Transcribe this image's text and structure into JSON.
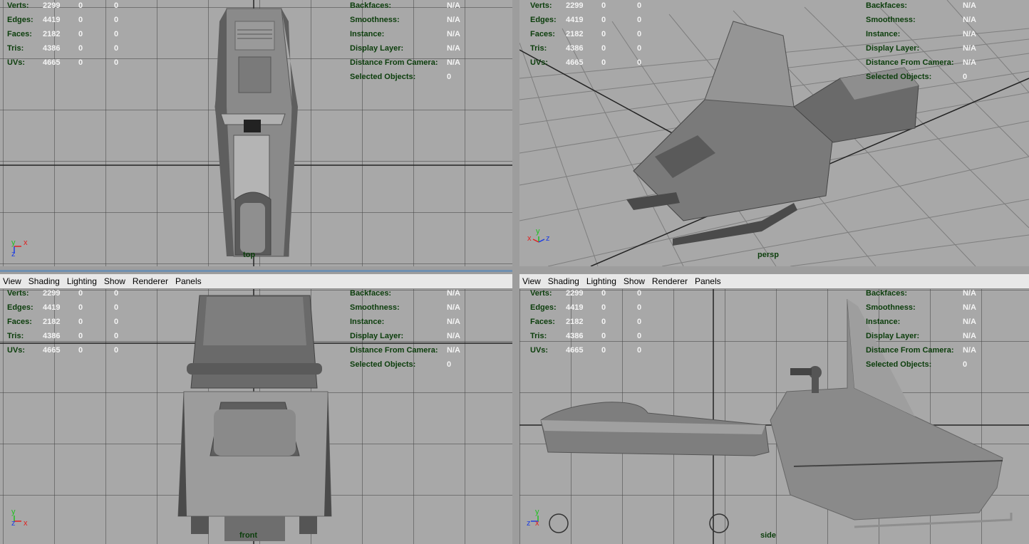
{
  "menu": [
    "View",
    "Shading",
    "Lighting",
    "Show",
    "Renderer",
    "Panels"
  ],
  "hud_stats": [
    {
      "label": "Verts:",
      "v1": "2299",
      "v2": "0",
      "v3": "0"
    },
    {
      "label": "Edges:",
      "v1": "4419",
      "v2": "0",
      "v3": "0"
    },
    {
      "label": "Faces:",
      "v1": "2182",
      "v2": "0",
      "v3": "0"
    },
    {
      "label": "Tris:",
      "v1": "4386",
      "v2": "0",
      "v3": "0"
    },
    {
      "label": "UVs:",
      "v1": "4665",
      "v2": "0",
      "v3": "0"
    }
  ],
  "hud_info": [
    {
      "label": "Backfaces:",
      "value": "N/A"
    },
    {
      "label": "Smoothness:",
      "value": "N/A"
    },
    {
      "label": "Instance:",
      "value": "N/A"
    },
    {
      "label": "Display Layer:",
      "value": "N/A"
    },
    {
      "label": "Distance From Camera:",
      "value": "N/A"
    },
    {
      "label": "Selected Objects:",
      "value": "0"
    }
  ],
  "cameras": {
    "top": "top",
    "persp": "persp",
    "front": "front",
    "side": "side"
  },
  "axes": {
    "x": "x",
    "y": "y",
    "z": "z"
  },
  "colors": {
    "axis_x": "#e02020",
    "axis_y": "#20c020",
    "axis_z": "#2040e0",
    "hud_label": "#0b3d0b",
    "hud_value": "#f4f4f4",
    "viewport_bg": "#a8a8a8"
  }
}
